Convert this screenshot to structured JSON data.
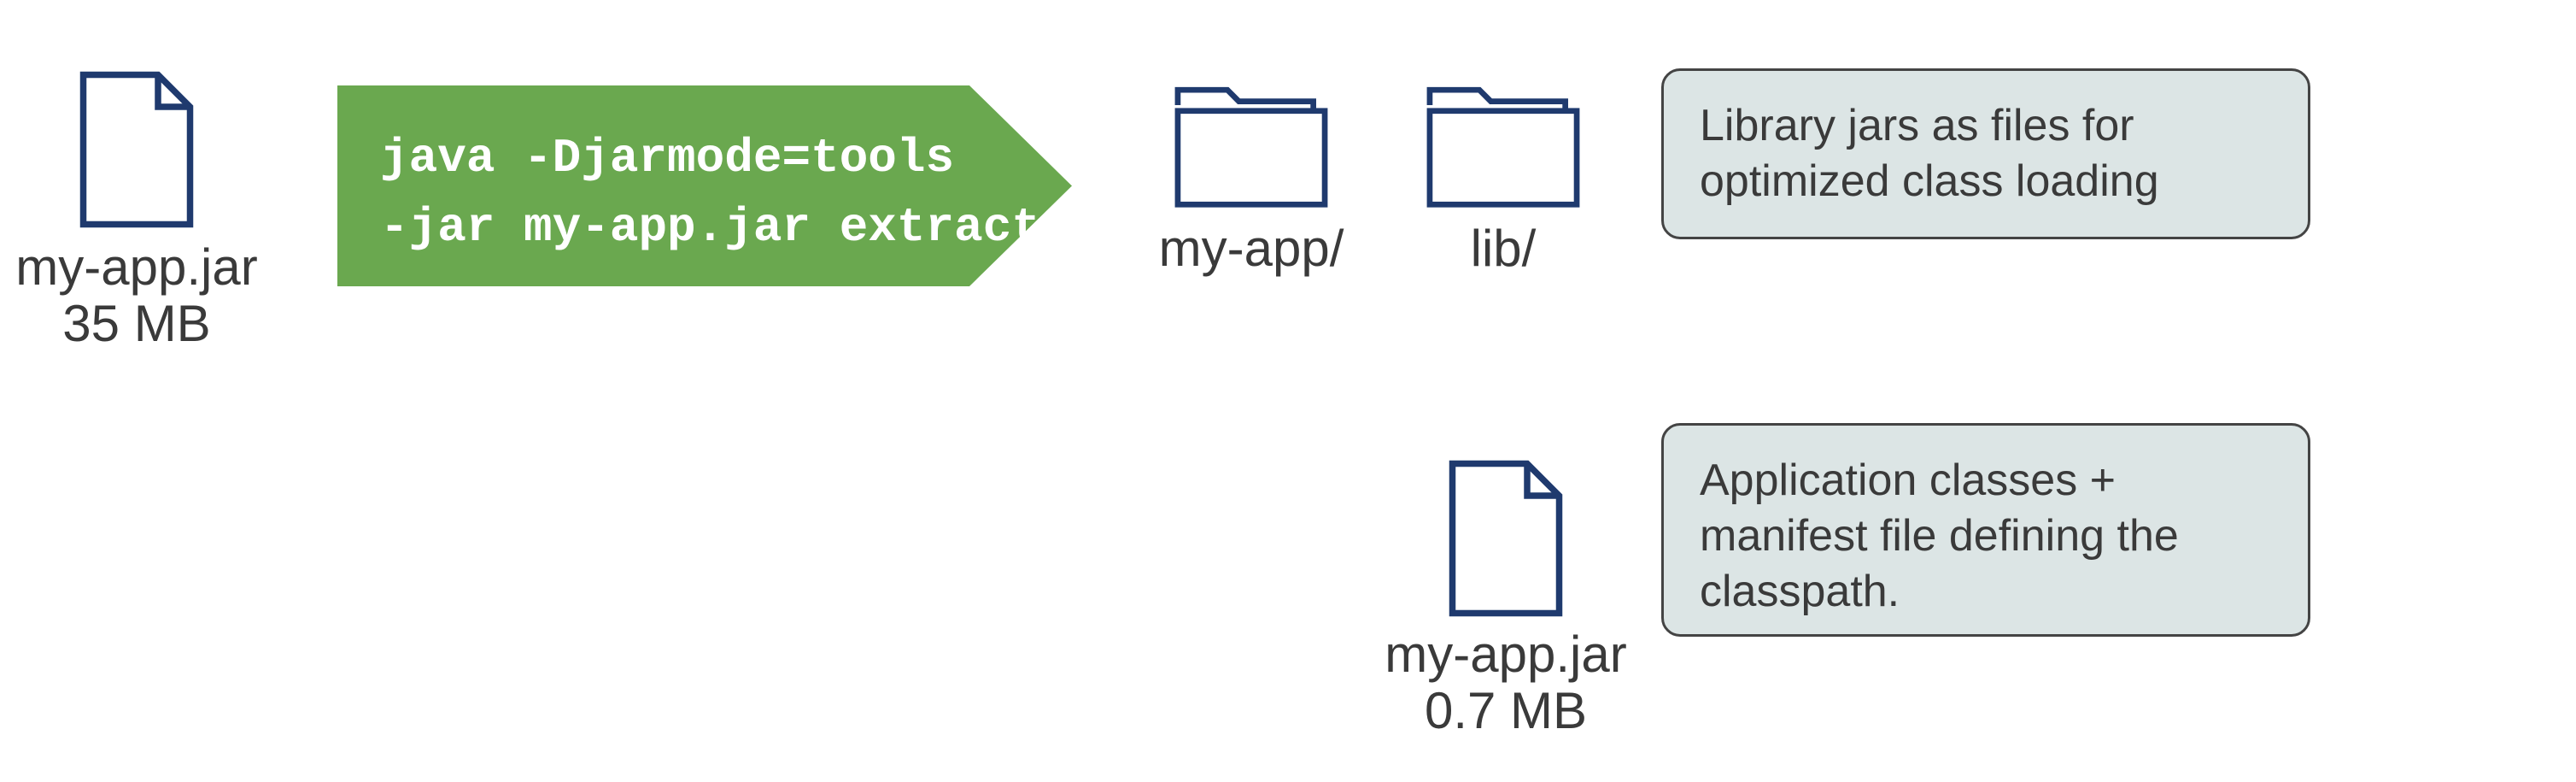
{
  "input": {
    "filename": "my-app.jar",
    "size": "35 MB"
  },
  "command": {
    "line1": "java -Djarmode=tools",
    "line2": "-jar my-app.jar extract"
  },
  "output": {
    "folder_app": "my-app/",
    "folder_lib": "lib/",
    "jar_name": "my-app.jar",
    "jar_size": "0.7 MB"
  },
  "descriptions": {
    "lib": "Library jars as files for optimized class loading",
    "jar": "Application classes + manifest file defining the classpath."
  },
  "colors": {
    "accent_green": "#6aa84f",
    "navy": "#1f3a6e",
    "box_bg": "#dce5e5",
    "text": "#3a3a3a"
  }
}
